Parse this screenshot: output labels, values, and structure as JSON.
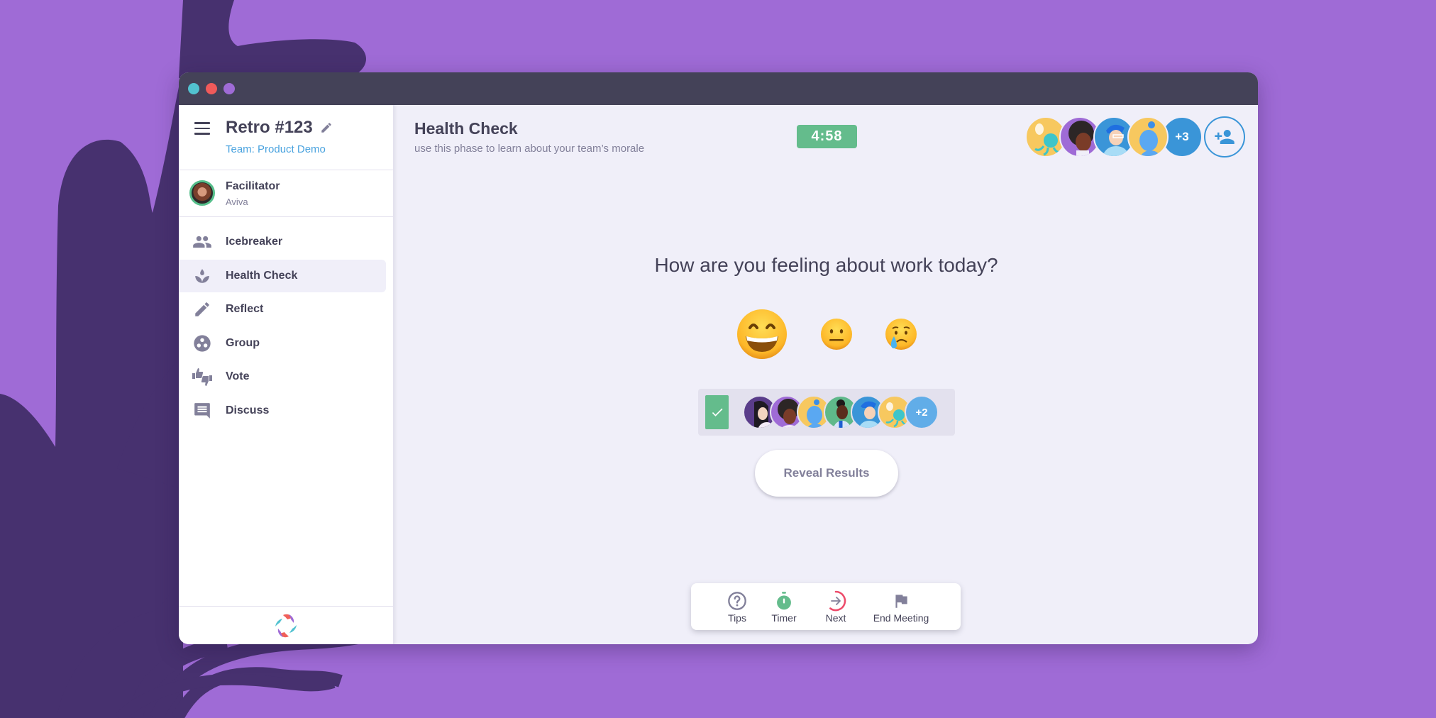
{
  "window": {
    "traffic_lights": [
      "#52c2d0",
      "#f05a5a",
      "#9f6bd6"
    ]
  },
  "sidebar": {
    "meeting_title": "Retro #123",
    "team_link": "Team: Product Demo",
    "facilitator_label": "Facilitator",
    "facilitator_name": "Aviva",
    "items": [
      {
        "label": "Icebreaker",
        "icon": "group-icon",
        "active": false
      },
      {
        "label": "Health Check",
        "icon": "spa-icon",
        "active": true
      },
      {
        "label": "Reflect",
        "icon": "pencil-icon",
        "active": false
      },
      {
        "label": "Group",
        "icon": "workspaces-icon",
        "active": false
      },
      {
        "label": "Vote",
        "icon": "thumbs-up-down-icon",
        "active": false
      },
      {
        "label": "Discuss",
        "icon": "chat-icon",
        "active": false
      }
    ]
  },
  "header": {
    "phase_title": "Health Check",
    "phase_description": "use this phase to learn about your team’s morale",
    "timer": "4:58",
    "participants_overflow": "+3"
  },
  "main": {
    "question": "How are you feeling about work today?",
    "emojis": [
      {
        "name": "grinning-face",
        "glyph": "😄",
        "selected": true
      },
      {
        "name": "neutral-face",
        "glyph": "😐",
        "selected": false
      },
      {
        "name": "crying-face",
        "glyph": "😢",
        "selected": false
      }
    ],
    "voters_overflow": "+2",
    "reveal_button": "Reveal Results"
  },
  "bottom_bar": {
    "tips": "Tips",
    "timer": "Timer",
    "next": "Next",
    "end_meeting": "End Meeting",
    "next_progress": 0.6
  },
  "colors": {
    "background": "#9f6bd6",
    "background_dark": "#47316f",
    "titlebar": "#444258",
    "accent_green": "#64bc8c",
    "accent_blue": "#3a95d8",
    "accent_red": "#ed4c6b",
    "text_dark": "#444258",
    "text_muted": "#82809a"
  }
}
